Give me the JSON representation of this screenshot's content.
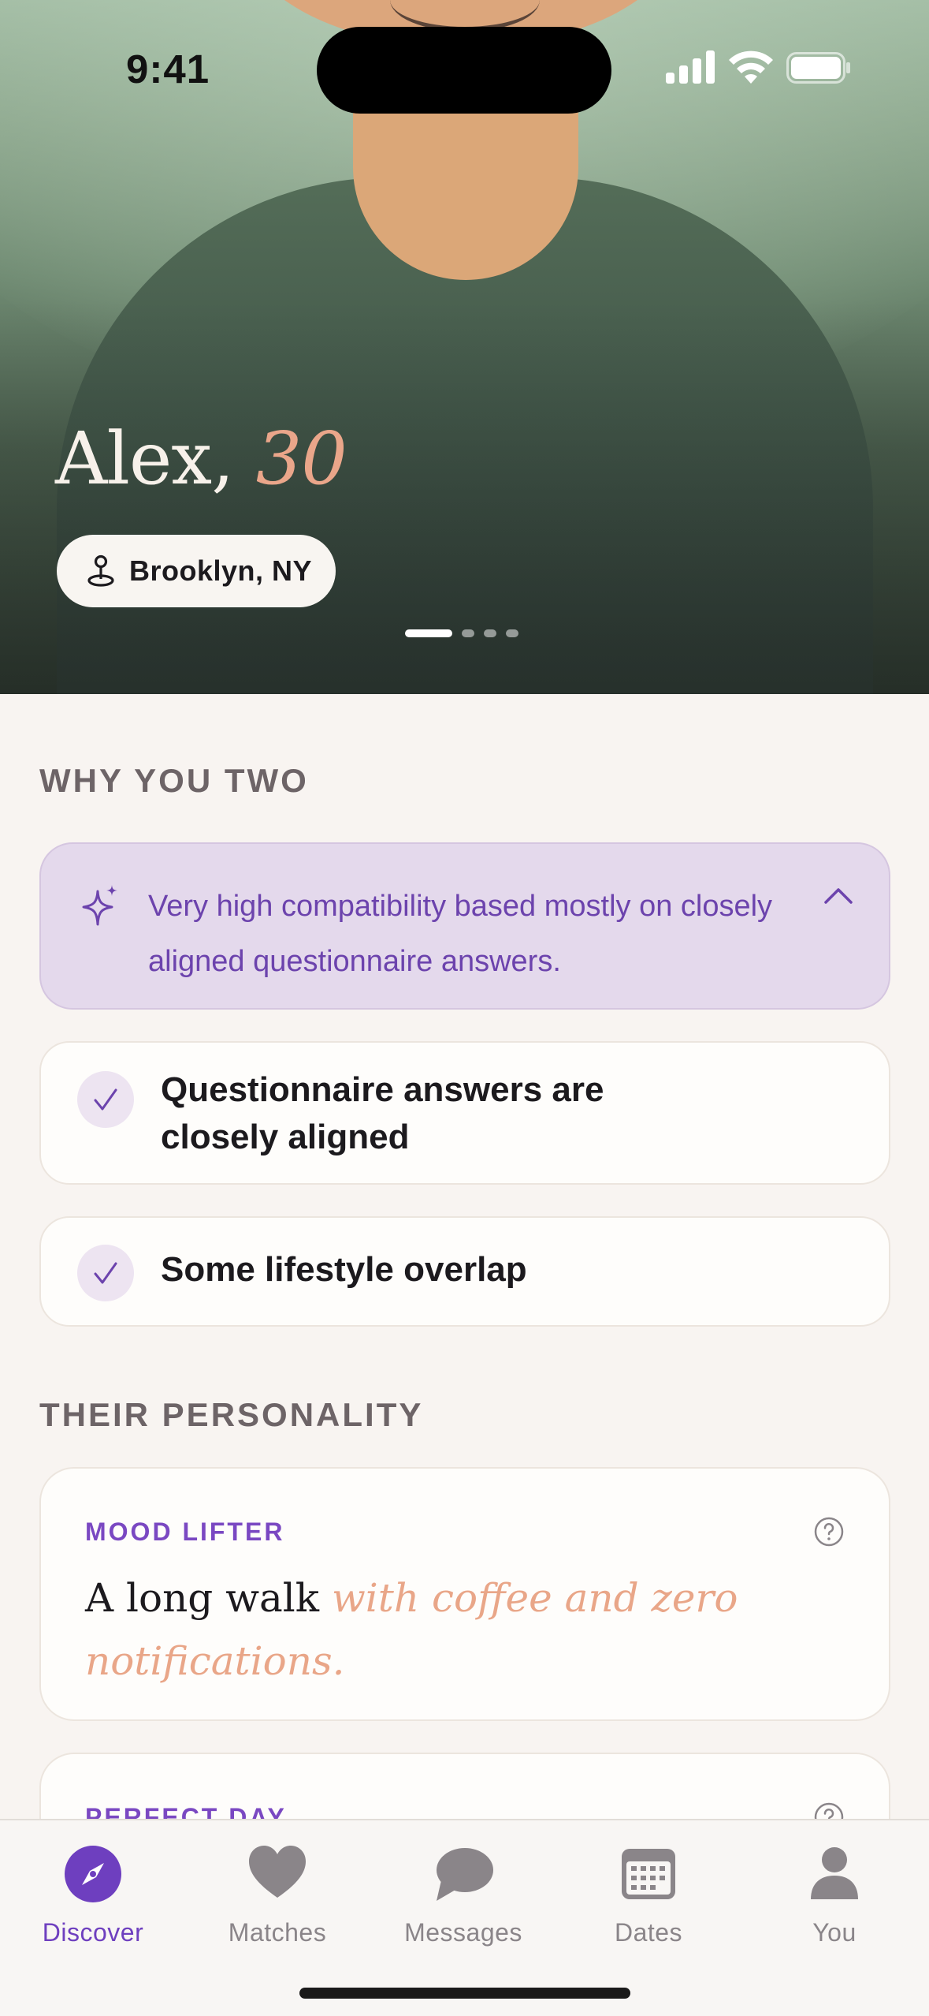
{
  "status_bar": {
    "time": "9:41"
  },
  "profile": {
    "name": "Alex,",
    "age": "30",
    "location": "Brooklyn, NY",
    "photo_count": 4,
    "current_photo": 1
  },
  "why_you_two": {
    "title": "WHY YOU TWO",
    "summary": "Very high compatibility based mostly on closely aligned questionnaire answers.",
    "reasons": [
      {
        "label": "Questionnaire answers are closely aligned",
        "line1": "Questionnaire answers are",
        "line2": "closely aligned"
      },
      {
        "label": "Some lifestyle overlap"
      }
    ]
  },
  "personality": {
    "title": "THEIR PERSONALITY",
    "prompts": [
      {
        "title": "MOOD LIFTER",
        "answer_plain": "A long walk ",
        "answer_accent": "with coffee and zero notifications."
      },
      {
        "title": "PERFECT DAY"
      }
    ]
  },
  "tab_bar": {
    "active": "Discover",
    "tabs": [
      {
        "label": "Discover",
        "icon": "compass-icon"
      },
      {
        "label": "Matches",
        "icon": "heart-icon"
      },
      {
        "label": "Messages",
        "icon": "chat-bubble-icon"
      },
      {
        "label": "Dates",
        "icon": "calendar-icon"
      },
      {
        "label": "You",
        "icon": "person-icon"
      }
    ]
  },
  "colors": {
    "accent_purple": "#6e3fbf",
    "accent_peach": "#e9a688",
    "ai_card_bg": "#e4d9ec",
    "page_bg": "#f8f4f1"
  }
}
